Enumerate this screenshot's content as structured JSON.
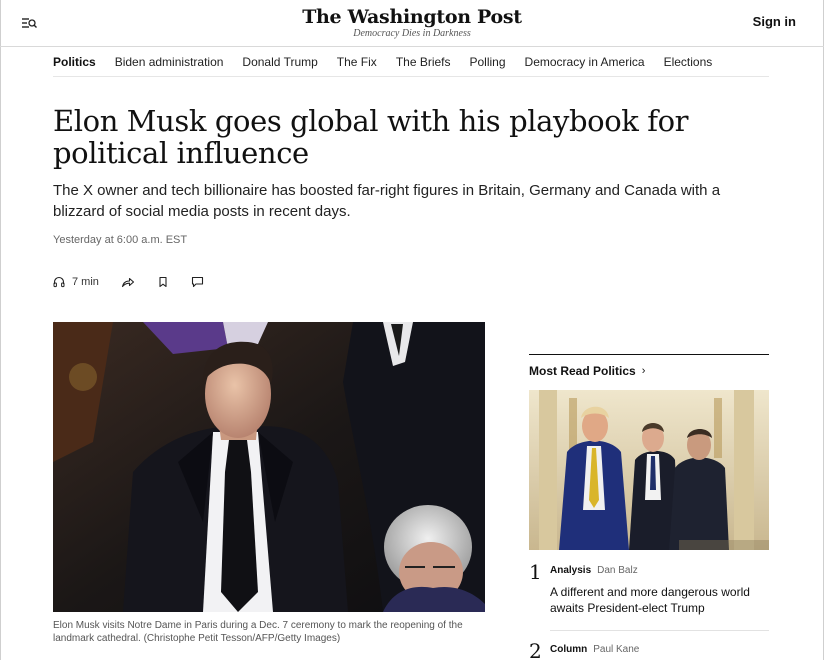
{
  "header": {
    "logo": "The Washington Post",
    "tagline": "Democracy Dies in Darkness",
    "signin_label": "Sign in",
    "menu_icon": "menu-search-icon"
  },
  "section_nav": {
    "items": [
      {
        "label": "Politics",
        "active": true
      },
      {
        "label": "Biden administration",
        "active": false
      },
      {
        "label": "Donald Trump",
        "active": false
      },
      {
        "label": "The Fix",
        "active": false
      },
      {
        "label": "The Briefs",
        "active": false
      },
      {
        "label": "Polling",
        "active": false
      },
      {
        "label": "Democracy in America",
        "active": false
      },
      {
        "label": "Elections",
        "active": false
      }
    ]
  },
  "article": {
    "headline": "Elon Musk goes global with his playbook for political influence",
    "dek": "The X owner and tech billionaire has boosted far-right figures in Britain, Germany and Canada with a blizzard of social media posts in recent days.",
    "timestamp": "Yesterday at 6:00 a.m. EST",
    "tools": {
      "listen_label": "7 min",
      "listen_icon": "headphones-icon",
      "share_icon": "share-icon",
      "save_icon": "bookmark-icon",
      "comment_icon": "comment-icon"
    },
    "caption": "Elon Musk visits Notre Dame in Paris during a Dec. 7 ceremony to mark the reopening of the landmark cathedral. (Christophe Petit Tesson/AFP/Getty Images)"
  },
  "sidebar": {
    "title": "Most Read Politics",
    "chevron": "›",
    "items": [
      {
        "rank": "1",
        "kicker": "Analysis",
        "author": "Dan Balz",
        "text": "A different and more dangerous world awaits President-elect Trump"
      },
      {
        "rank": "2",
        "kicker": "Column",
        "author": "Paul Kane",
        "text": ""
      }
    ]
  },
  "colors": {
    "text": "#111111",
    "muted": "#666666",
    "rule": "#e6e6e6"
  }
}
